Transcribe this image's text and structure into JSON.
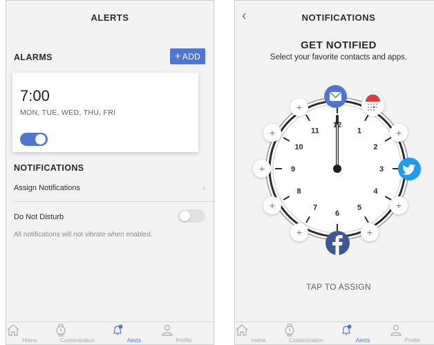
{
  "colors": {
    "accent": "#4f77d2",
    "background": "#f3f3f4",
    "twitter": "#1d9bf0",
    "facebook": "#3b5998"
  },
  "alerts_screen": {
    "header_title": "ALERTS",
    "alarms_title": "ALARMS",
    "add_button": {
      "icon": "plus-icon",
      "label": "ADD"
    },
    "alarm": {
      "time": "7:00",
      "days": "MON, TUE, WED, THU, FRI",
      "enabled": true
    },
    "notifications_title": "NOTIFICATIONS",
    "assign_label": "Assign Notifications",
    "dnd_label": "Do Not Disturb",
    "dnd_enabled": false,
    "dnd_note": "All notifications will not vibrate when enabled."
  },
  "notifications_screen": {
    "header_title": "NOTIFICATIONS",
    "back_icon": "chevron-left-icon",
    "title": "GET NOTIFIED",
    "subtitle": "Select your favorite contacts and apps.",
    "tap_label": "TAP TO ASSIGN",
    "clock_numbers": [
      "12",
      "1",
      "2",
      "3",
      "4",
      "5",
      "6",
      "7",
      "8",
      "9",
      "10",
      "11"
    ],
    "assigned_apps": [
      {
        "hour": 12,
        "icon": "mail-icon"
      },
      {
        "hour": 1,
        "icon": "calendar-icon"
      },
      {
        "hour": 3,
        "icon": "twitter-icon"
      },
      {
        "hour": 6,
        "icon": "facebook-icon"
      }
    ],
    "add_slot_symbol": "+"
  },
  "tabbar": {
    "tabs": [
      {
        "label": "Home",
        "icon": "home-icon"
      },
      {
        "label": "Customization",
        "icon": "watch-icon"
      },
      {
        "label": "Alerts",
        "icon": "bell-icon",
        "active": true
      },
      {
        "label": "Profile",
        "icon": "profile-icon"
      }
    ]
  }
}
